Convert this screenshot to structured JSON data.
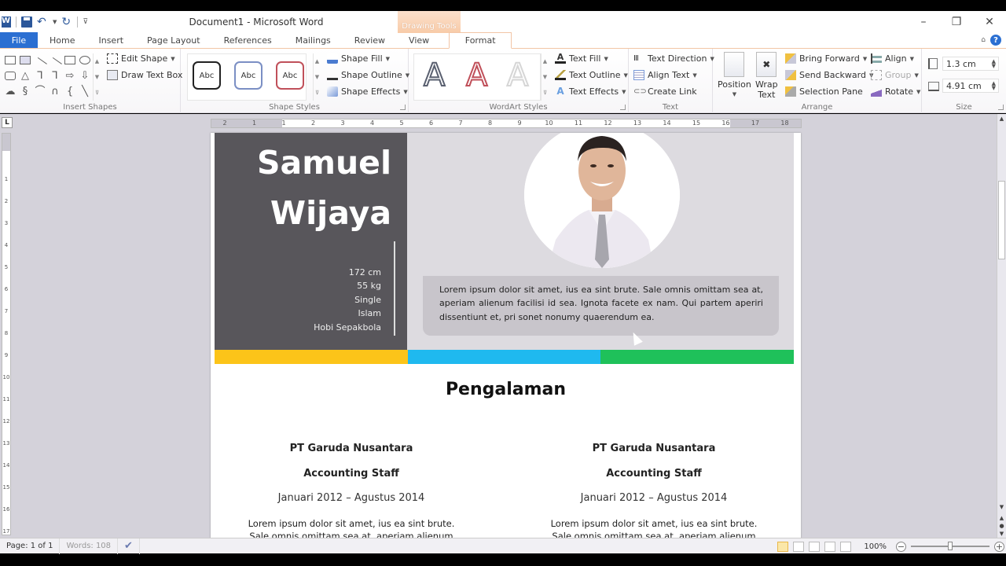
{
  "window": {
    "title": "Document1  -  Microsoft Word",
    "context_tab_group": "Drawing Tools",
    "controls": {
      "minimize": "–",
      "restore": "❐",
      "close": "✕"
    }
  },
  "quick_access": {
    "icons": [
      "word-icon",
      "save-icon",
      "undo-icon",
      "redo-icon",
      "customize-icon"
    ]
  },
  "tabs": [
    {
      "label": "File"
    },
    {
      "label": "Home"
    },
    {
      "label": "Insert"
    },
    {
      "label": "Page Layout"
    },
    {
      "label": "References"
    },
    {
      "label": "Mailings"
    },
    {
      "label": "Review"
    },
    {
      "label": "View"
    },
    {
      "label": "Format",
      "active": true
    }
  ],
  "ribbon": {
    "insert_shapes": {
      "label": "Insert Shapes",
      "edit_shape": "Edit Shape",
      "draw_text_box": "Draw Text Box"
    },
    "shape_styles": {
      "label": "Shape Styles",
      "presets": [
        {
          "text": "Abc",
          "color": "#222222"
        },
        {
          "text": "Abc",
          "color": "#7b8fc4"
        },
        {
          "text": "Abc",
          "color": "#c0505a"
        }
      ],
      "shape_fill": "Shape Fill",
      "shape_outline": "Shape Outline",
      "shape_effects": "Shape Effects"
    },
    "wordart_styles": {
      "label": "WordArt Styles",
      "presets": [
        {
          "text": "A",
          "color": "#5a6070"
        },
        {
          "text": "A",
          "color": "#c0505a"
        },
        {
          "text": "A",
          "color": "#d6d6d6"
        }
      ],
      "text_fill": "Text Fill",
      "text_outline": "Text Outline",
      "text_effects": "Text Effects"
    },
    "text": {
      "label": "Text",
      "text_direction": "Text Direction",
      "align_text": "Align Text",
      "create_link": "Create Link"
    },
    "arrange": {
      "label": "Arrange",
      "position": "Position",
      "wrap_text_1": "Wrap",
      "wrap_text_2": "Text",
      "bring_forward": "Bring Forward",
      "send_backward": "Send Backward",
      "selection_pane": "Selection Pane",
      "align": "Align",
      "group": "Group",
      "rotate": "Rotate"
    },
    "size": {
      "label": "Size",
      "height": "1.3 cm",
      "width": "4.91 cm"
    }
  },
  "ruler": {
    "h_ticks": [
      "2",
      "1",
      "1",
      "2",
      "3",
      "4",
      "5",
      "6",
      "7",
      "8",
      "9",
      "10",
      "11",
      "12",
      "13",
      "14",
      "15",
      "16",
      "17",
      "18"
    ],
    "v_ticks": [
      "1",
      "2",
      "3",
      "4",
      "5",
      "6",
      "7",
      "8",
      "9",
      "10",
      "11",
      "12",
      "13",
      "14",
      "15",
      "16",
      "17"
    ],
    "tab_stop": "L"
  },
  "document": {
    "first_name": "Samuel",
    "last_name": "Wijaya",
    "facts": [
      "172 cm",
      "55 kg",
      "Single",
      "Islam",
      "Hobi Sepakbola"
    ],
    "about": "Lorem ipsum dolor sit amet, ius ea sint brute. Sale omnis omittam sea at, aperiam alienum facilisi id sea. Ignota facete ex nam. Qui partem aperiri dissentiunt et, pri sonet nonumy quaerendum ea.",
    "photo_alt": "Portrait of smiling man in white shirt and grey tie",
    "accent_bars": [
      "#fcc419",
      "#1fb9ef",
      "#1fc15a"
    ],
    "section_title": "Pengalaman",
    "jobs": [
      {
        "company": "PT Garuda Nusantara",
        "role": "Accounting Staff",
        "period": "Januari 2012 – Agustus 2014",
        "desc_1": "Lorem ipsum dolor sit amet, ius ea sint brute.",
        "desc_2": "Sale omnis omittam sea at, aperiam alienum"
      },
      {
        "company": "PT Garuda Nusantara",
        "role": "Accounting Staff",
        "period": "Januari 2012 – Agustus 2014",
        "desc_1": "Lorem ipsum dolor sit amet, ius ea sint brute.",
        "desc_2": "Sale omnis omittam sea at, aperiam alienum"
      }
    ]
  },
  "status": {
    "page": "Page: 1 of 1",
    "words": "Words: 108",
    "zoom": "100%",
    "zoom_percent": 100
  },
  "colors": {
    "accent": "#2b6fd2",
    "context_tab": "#f8cba8",
    "dark_panel": "#58565b",
    "light_panel": "#dddbe0"
  }
}
